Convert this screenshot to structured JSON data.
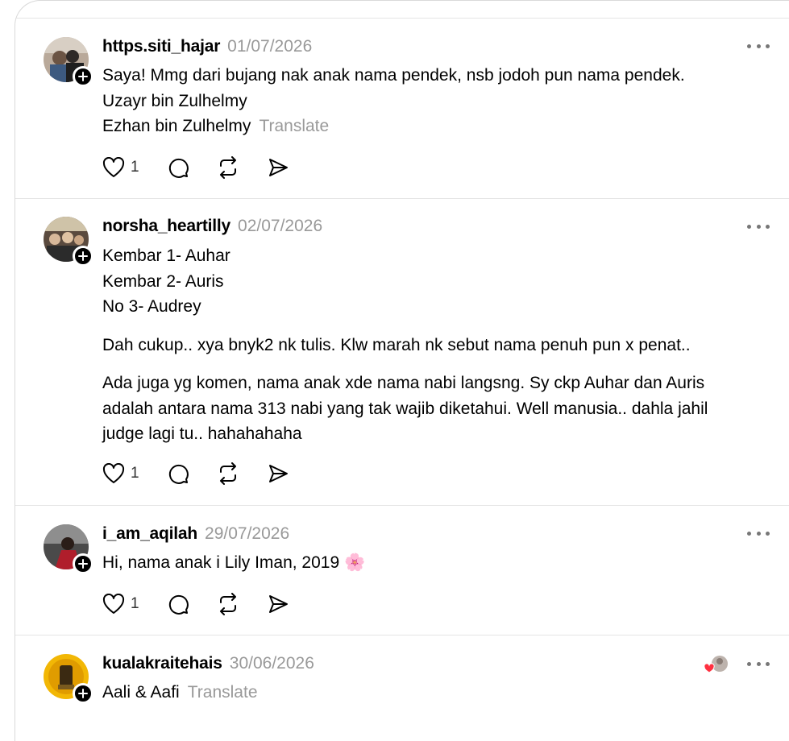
{
  "colors": {
    "text": "#000000",
    "muted": "#999999",
    "divider": "#e5e5e5",
    "heart_badge": "#ff3040"
  },
  "posts": [
    {
      "username": "https.siti_hajar",
      "date": "01/07/2026",
      "lines": [
        "Saya! Mmg dari bujang nak anak nama pendek, nsb jodoh pun nama pendek.",
        "Uzayr bin Zulhelmy",
        "Ezhan bin Zulhelmy"
      ],
      "translate": "Translate",
      "like_count": "1"
    },
    {
      "username": "norsha_heartilly",
      "date": "02/07/2026",
      "lines": [
        "Kembar 1- Auhar",
        "Kembar 2- Auris",
        "No 3- Audrey"
      ],
      "paragraph2": "Dah cukup.. xya bnyk2 nk tulis. Klw marah nk sebut nama penuh pun x penat..",
      "paragraph3": [
        "Ada juga yg komen, nama anak xde nama nabi langsng. Sy ckp Auhar dan Auris",
        "adalah antara nama 313 nabi yang tak wajib diketahui. Well manusia.. dahla jahil",
        "judge lagi tu.. hahahahaha"
      ],
      "like_count": "1"
    },
    {
      "username": "i_am_aqilah",
      "date": "29/07/2026",
      "text": "Hi, nama anak i Lily Iman, 2019",
      "emoji": "🌸",
      "like_count": "1"
    },
    {
      "username": "kualakraitehais",
      "date": "30/06/2026",
      "text": "Aali & Aafi",
      "translate": "Translate"
    }
  ],
  "icons": {
    "like": "heart-icon",
    "reply": "comment-icon",
    "repost": "repost-icon",
    "share": "send-icon",
    "more": "more-dots-icon",
    "follow": "plus-icon"
  }
}
